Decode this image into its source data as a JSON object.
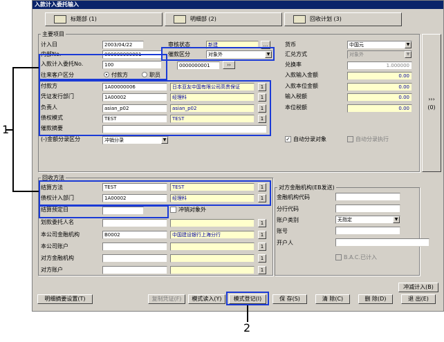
{
  "window": {
    "title": "入款计入委托输入"
  },
  "tabs": [
    {
      "label": "标题部 (1)"
    },
    {
      "label": "明细部 (2)"
    },
    {
      "label": "回收计划 (3)"
    }
  ],
  "main": {
    "group_title": "主要项目",
    "entry_date_label": "计入日",
    "entry_date": "2003/04/22",
    "inner_no_label": "内部No.",
    "inner_no": "000000000001",
    "inflow_no_label": "入款计入委托No.",
    "inflow_no": "100",
    "customer_type_label": "往来客户区分",
    "radio_payer": "付款方",
    "radio_staff": "职员",
    "review_status_label": "审核状态",
    "review_status": "新建",
    "debt_type_label": "催款区分",
    "debt_type": "对象外",
    "extra_code": "0000000001",
    "payer_label": "付款方",
    "payer_code": "1A00000006",
    "payer_name": "日本亚友中国有限公司高贵保证",
    "dept_label": "凭证发行部门",
    "dept_code": "1A00002",
    "dept_name": "经理科",
    "person_label": "负责人",
    "person_code": "asian_p02",
    "person_name": "asian_p02",
    "mode_label": "债权模式",
    "mode_code": "TEST",
    "mode_name": "TEST",
    "summary_label": "催款摘要",
    "split_label": "(-)金额分录区分",
    "split_value": "冲销分录",
    "currency_label": "货币",
    "currency": "中国元",
    "rate_method_label": "汇兑方式",
    "rate_method": "对象外",
    "rate_label": "兑换率",
    "rate": "1.000000",
    "in_amount_label": "入款输入金额",
    "in_amount": "0.00",
    "base_amount_label": "入款本位金额",
    "base_amount": "0.00",
    "tax_in_label": "输入税额",
    "tax_in": "0.00",
    "tax_base_label": "本位税额",
    "tax_base": "0.00",
    "auto_split_label": "自动分录对象",
    "auto_exec_label": "自动分录执行"
  },
  "collect": {
    "group_title": "回收方法",
    "method_label": "结算方法",
    "method_code": "TEST",
    "method_name": "TEST",
    "dept_label": "债权计入部门",
    "dept_code": "1A00002",
    "dept_name": "经理科",
    "date_label": "结算预定日",
    "offset_label": "冲销对象外",
    "agent_label": "划款委托人名",
    "bank_label": "本公司金融机构",
    "bank_code": "B0002",
    "bank_name": "中国建设银行上海分行",
    "account_label": "本公司账户",
    "cp_bank_label": "对方金融机构",
    "cp_account_label": "对方账户"
  },
  "fin": {
    "group_title": "对方金融机构(EB发送)",
    "code_label": "金融机构代码",
    "branch_label": "分行代码",
    "acct_type_label": "账户类别",
    "acct_type": "无指定",
    "acct_no_label": "账号",
    "holder_label": "开户人",
    "bac_label": "B.A.C.已计入"
  },
  "side": {
    "label": "(0)"
  },
  "buttons": {
    "offset_input": "冲减计入(B)",
    "summary_setting": "明细摘要设置(T)",
    "copy_voucher": "复制凭证(F)",
    "mode_load": "模式读入(Y)",
    "mode_register": "模式登记(I)",
    "save": "保 存(S)",
    "clear": "清 除(C)",
    "delete": "删 除(D)",
    "exit": "退 出(E)"
  },
  "annotations": {
    "one": "1",
    "two": "2"
  }
}
